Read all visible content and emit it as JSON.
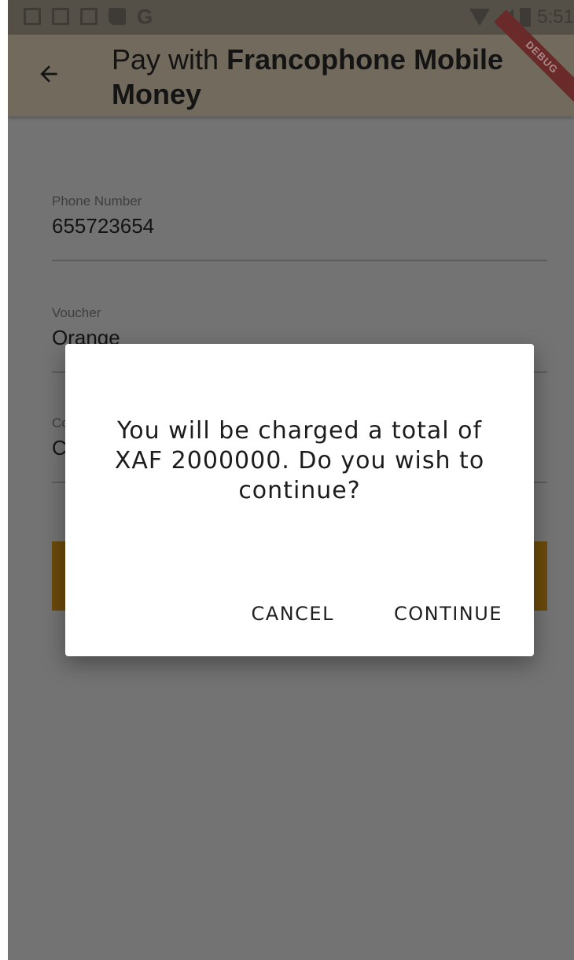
{
  "status_bar": {
    "left_icons": [
      "gmail-icon",
      "card-icon",
      "card-icon",
      "sd-card-icon",
      "google-icon"
    ],
    "google_letter": "G",
    "time": "5:51"
  },
  "app_bar": {
    "title_prefix": "Pay with ",
    "title_bold": "Francophone Mobile Money",
    "debug_banner": "DEBUG"
  },
  "form": {
    "phone": {
      "label": "Phone Number",
      "value": "655723654"
    },
    "voucher": {
      "label": "Voucher",
      "value": "Orange"
    },
    "third": {
      "label": "Co",
      "value": "C"
    }
  },
  "dialog": {
    "message": "You will be charged a total of XAF 2000000. Do you wish to continue?",
    "cancel_label": "CANCEL",
    "continue_label": "CONTINUE"
  },
  "colors": {
    "scrim": "#737373",
    "app_bar": "#716a5d",
    "pay_button": "#6b4a0b",
    "dialog_bg": "#ffffff"
  }
}
